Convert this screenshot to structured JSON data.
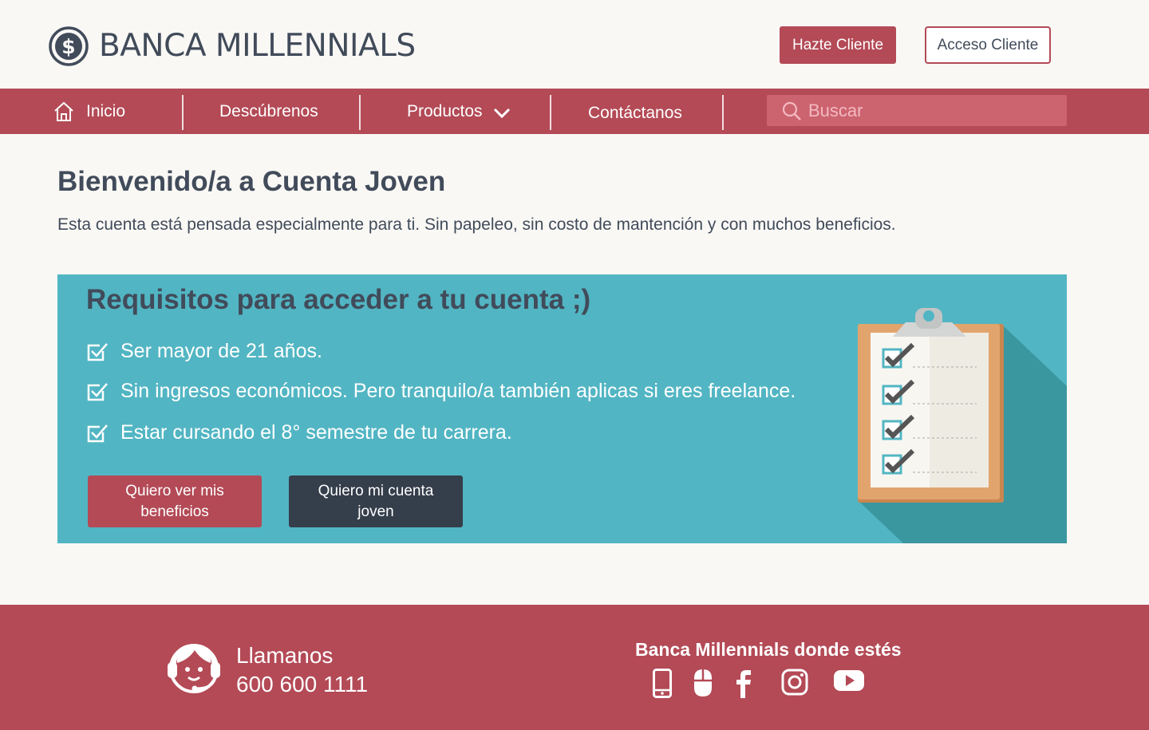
{
  "header": {
    "brand": "BANCA MILLENNIALS",
    "hazte_label": "Hazte Cliente",
    "acceso_label": "Acceso Cliente"
  },
  "nav": {
    "inicio": "Inicio",
    "descubrenos": "Descúbrenos",
    "productos": "Productos",
    "contactanos": "Contáctanos",
    "search_placeholder": "Buscar"
  },
  "main": {
    "title": "Bienvenido/a a Cuenta Joven",
    "subtitle": "Esta cuenta está pensada especialmente para ti.  Sin papeleo, sin costo de mantención y con muchos beneficios."
  },
  "banner": {
    "title": "Requisitos para acceder a tu cuenta ;)",
    "requirements": [
      "Ser mayor de 21 años.",
      "Sin ingresos económicos. Pero tranquilo/a también aplicas si eres freelance.",
      "Estar cursando el 8° semestre de tu carrera."
    ],
    "btn_beneficios": "Quiero ver mis beneficios",
    "btn_cuenta": "Quiero mi cuenta joven"
  },
  "footer": {
    "call_label": "Llamanos",
    "call_number": "600 600 1111",
    "social_title": "Banca Millennials donde estés",
    "social_icons": [
      "phone-icon",
      "mouse-icon",
      "facebook-icon",
      "instagram-icon",
      "youtube-icon"
    ]
  },
  "colors": {
    "primary": "#b34a56",
    "dark": "#414b5a",
    "banner": "#52b5c3",
    "button_dark": "#353e4b"
  }
}
